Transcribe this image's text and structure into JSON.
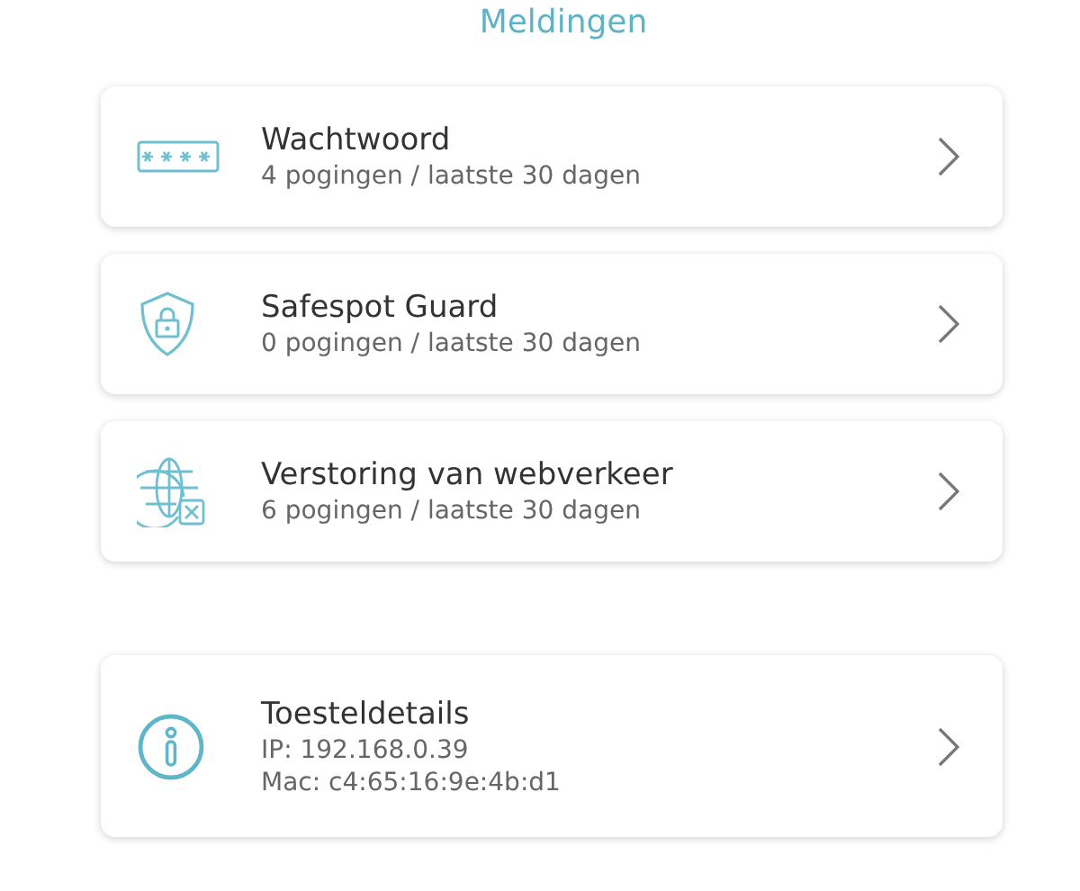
{
  "header": {
    "title": "Meldingen"
  },
  "notifications": [
    {
      "kind": "password",
      "title": "Wachtwoord",
      "subtitle": "4 pogingen / laatste 30 dagen"
    },
    {
      "kind": "shield",
      "title": "Safespot Guard",
      "subtitle": "0 pogingen / laatste 30 dagen"
    },
    {
      "kind": "globe",
      "title": "Verstoring van webverkeer",
      "subtitle": "6 pogingen / laatste 30 dagen"
    }
  ],
  "device": {
    "title": "Toesteldetails",
    "lines": [
      "IP: 192.168.0.39",
      "Mac: c4:65:16:9e:4b:d1"
    ]
  }
}
